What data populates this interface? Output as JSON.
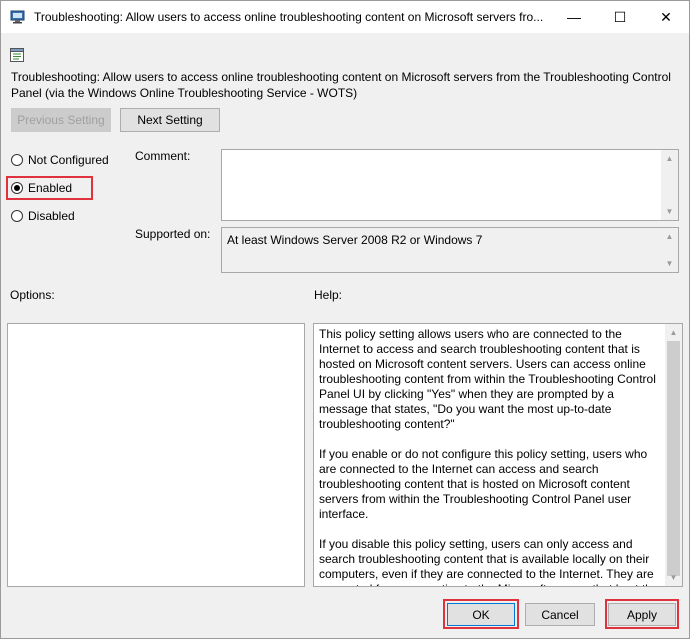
{
  "window": {
    "title": "Troubleshooting: Allow users to access online troubleshooting content on Microsoft servers fro...",
    "controls": {
      "minimize": "—",
      "maximize": "☐",
      "close": "✕"
    }
  },
  "policy": {
    "icon": "policy-setting-icon",
    "full_title": "Troubleshooting: Allow users to access online troubleshooting content on Microsoft servers from the Troubleshooting Control Panel (via the Windows Online Troubleshooting Service - WOTS)"
  },
  "nav": {
    "previous_label": "Previous Setting",
    "next_label": "Next Setting"
  },
  "state": {
    "options": [
      {
        "label": "Not Configured",
        "selected": false
      },
      {
        "label": "Enabled",
        "selected": true
      },
      {
        "label": "Disabled",
        "selected": false
      }
    ]
  },
  "comment": {
    "label": "Comment:",
    "value": ""
  },
  "supported": {
    "label": "Supported on:",
    "value": "At least Windows Server 2008 R2 or Windows 7"
  },
  "options_panel": {
    "label": "Options:"
  },
  "help_panel": {
    "label": "Help:",
    "text": "This policy setting allows users who are connected to the Internet to access and search troubleshooting content that is hosted on Microsoft content servers. Users can access online troubleshooting content from within the Troubleshooting Control Panel UI by clicking \"Yes\" when they are prompted by a message that states, \"Do you want the most up-to-date troubleshooting content?\"\n\nIf you enable or do not configure this policy setting, users who are connected to the Internet can access and search troubleshooting content that is hosted on Microsoft content servers from within the Troubleshooting Control Panel user interface.\n\nIf you disable this policy setting, users can only access and search troubleshooting content that is available locally on their computers, even if they are connected to the Internet. They are prevented from connecting to the Microsoft servers that host the Windows Online Troubleshooting Service."
  },
  "footer": {
    "ok_label": "OK",
    "cancel_label": "Cancel",
    "apply_label": "Apply"
  }
}
